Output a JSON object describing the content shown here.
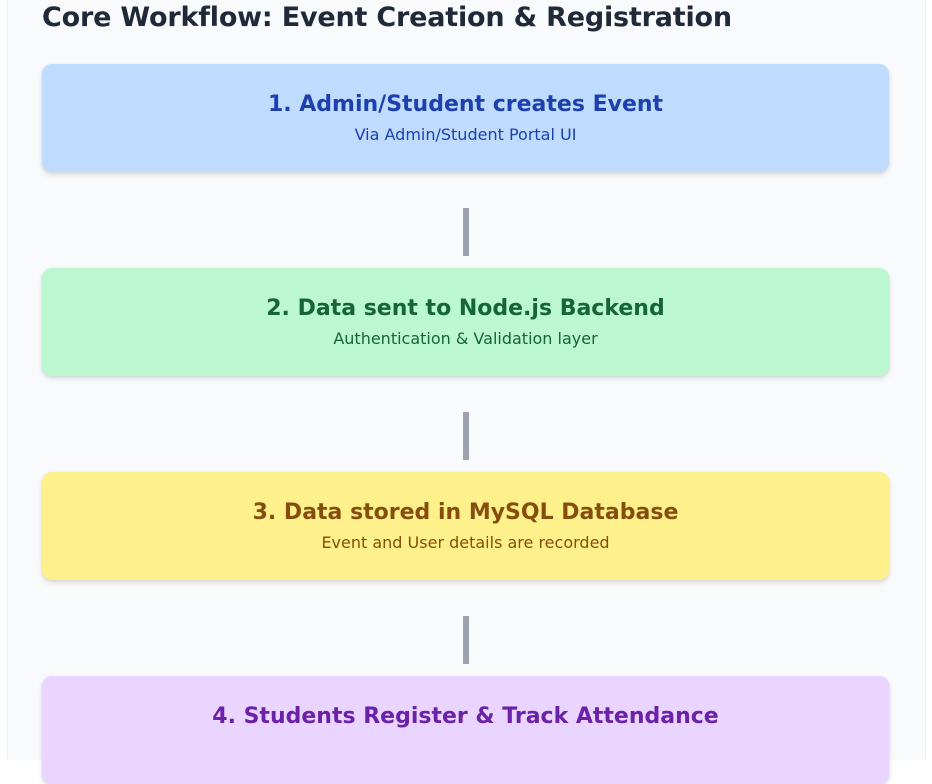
{
  "header": {
    "title": "Core Workflow: Event Creation & Registration"
  },
  "steps": [
    {
      "title": "1. Admin/Student creates Event",
      "subtitle": "Via Admin/Student Portal UI",
      "bg": "#bfdbfe",
      "color": "#1e40af"
    },
    {
      "title": "2. Data sent to Node.js Backend",
      "subtitle": "Authentication & Validation layer",
      "bg": "#bbf7d0",
      "color": "#166534"
    },
    {
      "title": "3. Data stored in MySQL Database",
      "subtitle": "Event and User details are recorded",
      "bg": "#fef08a",
      "color": "#854d0e"
    },
    {
      "title": "4. Students Register & Track Attendance",
      "subtitle": "",
      "bg": "#e9d5ff",
      "color": "#6b21a8"
    }
  ],
  "connector_color": "#9ca3af"
}
